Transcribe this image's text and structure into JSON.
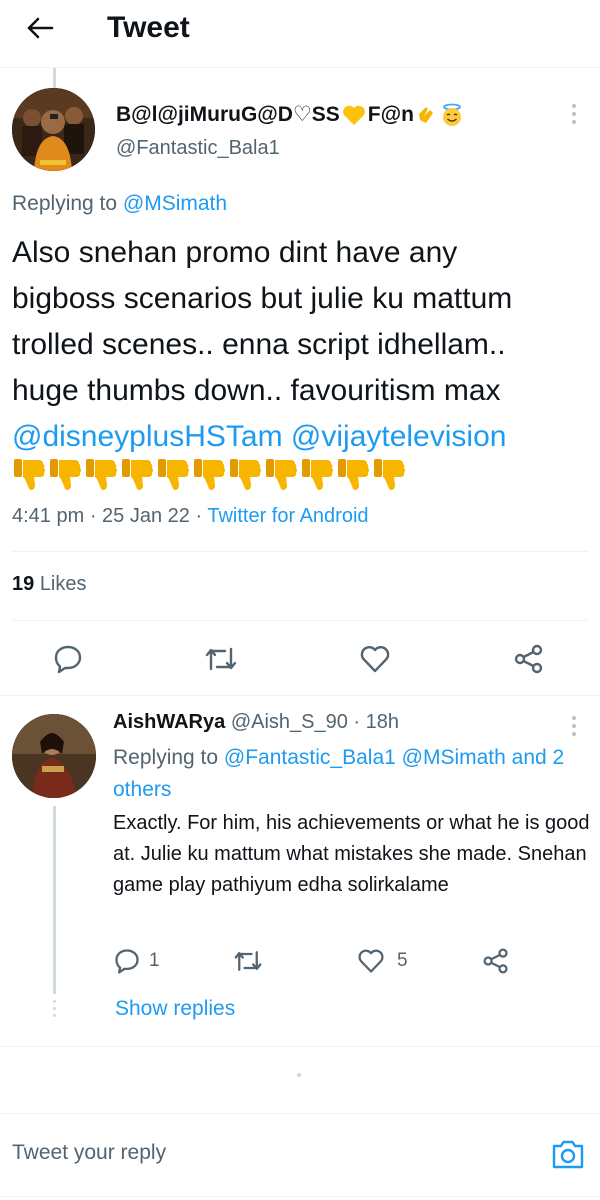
{
  "header": {
    "title": "Tweet"
  },
  "main_tweet": {
    "display_name": "B@l@jiMuruG@D♡SS",
    "display_name_suffix": "F@n",
    "handle": "@Fantastic_Bala1",
    "replying_prefix": "Replying to",
    "replying_to": "@MSimath",
    "text_lines": [
      "Also snehan promo dint have any",
      "bigboss scenarios but julie ku mattum",
      "trolled scenes.. enna script idhellam..",
      "huge thumbs down.. favouritism max"
    ],
    "mention_1": "@disneyplusHSTam",
    "mention_2": "@vijaytelevision",
    "thumbs_down_count": 11,
    "time": "4:41 pm",
    "date": "25 Jan 22",
    "source": "Twitter for Android",
    "likes_count": "19",
    "likes_label": "Likes"
  },
  "reply": {
    "display_name": "AishWARya",
    "handle": "@Aish_S_90",
    "time": "18h",
    "replying_prefix": "Replying to",
    "replying_to": "@Fantastic_Bala1 @MSimath and 2 others",
    "text": "Exactly. For him, his achievements or what he is good at. Julie ku mattum what mistakes she made. Snehan game play pathiyum edha solirkalame",
    "reply_count": "1",
    "like_count": "5",
    "show_replies": "Show replies"
  },
  "compose": {
    "placeholder": "Tweet your reply"
  },
  "colors": {
    "link": "#1d9bf0",
    "muted": "#536471",
    "text": "#0f1419",
    "divider": "#eff3f4",
    "emoji_yellow": "#f7b500"
  }
}
